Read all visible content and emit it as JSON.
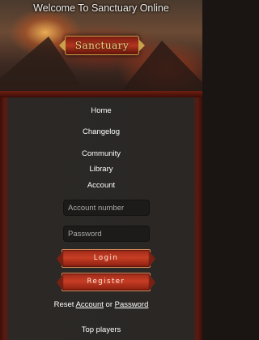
{
  "header": {
    "title": "Welcome To Sanctuary Online",
    "logo_text": "Sanctuary"
  },
  "nav": [
    {
      "label": "Home"
    },
    {
      "label": "Changelog"
    },
    {
      "label": "Community"
    },
    {
      "label": "Library"
    },
    {
      "label": "Account"
    }
  ],
  "login": {
    "account_placeholder": "Account number",
    "password_placeholder": "Password",
    "login_label": "Login",
    "register_label": "Register",
    "reset_prefix": "Reset",
    "reset_account_link": "Account",
    "reset_or": "or",
    "reset_password_link": "Password"
  },
  "footer": {
    "top_players": "Top players"
  },
  "colors": {
    "panel_bg": "#2a2725",
    "border_red": "#5c1a10",
    "button_red": "#c73e24",
    "text": "#ffffff"
  }
}
